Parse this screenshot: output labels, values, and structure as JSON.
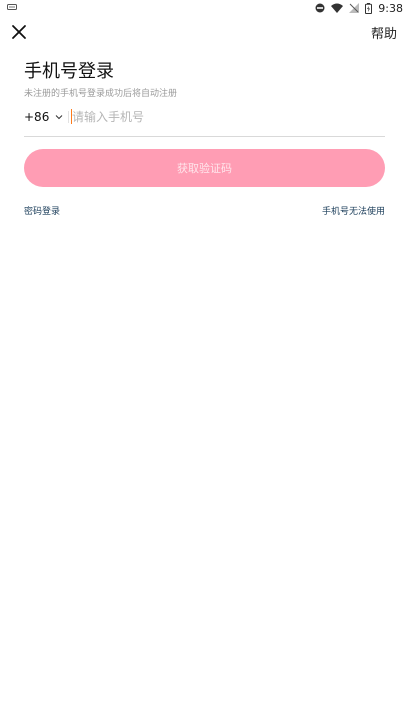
{
  "status_bar": {
    "time": "9:38",
    "icons": [
      "notification-icon",
      "dnd-icon",
      "wifi-icon",
      "no-signal-icon",
      "battery-icon"
    ]
  },
  "header": {
    "close_icon": "close-icon",
    "help_label": "帮助"
  },
  "login": {
    "title": "手机号登录",
    "subtitle": "未注册的手机号登录成功后将自动注册",
    "country_code": "+86",
    "phone_placeholder": "请输入手机号",
    "phone_value": "",
    "get_code_label": "获取验证码",
    "password_login_label": "密码登录",
    "phone_unavailable_label": "手机号无法使用"
  },
  "colors": {
    "button_bg": "#ff9db4",
    "caret": "#ff7a1a",
    "link": "#1b3d5a"
  }
}
